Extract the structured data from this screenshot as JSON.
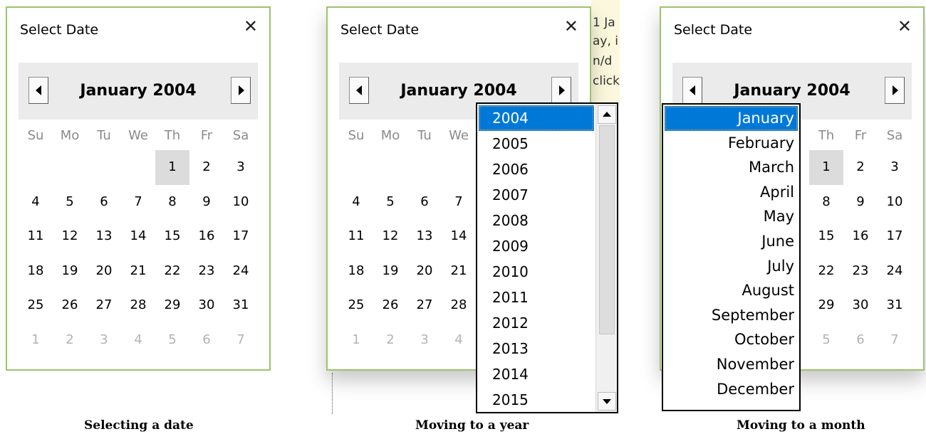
{
  "weekdays": [
    "Su",
    "Mo",
    "Tu",
    "We",
    "Th",
    "Fr",
    "Sa"
  ],
  "panels": [
    {
      "title": "Select Date",
      "month": "January",
      "year": "2004",
      "caption": "Selecting a date",
      "weeks": [
        [
          "",
          "",
          "",
          "",
          "1",
          "2",
          "3"
        ],
        [
          "4",
          "5",
          "6",
          "7",
          "8",
          "9",
          "10"
        ],
        [
          "11",
          "12",
          "13",
          "14",
          "15",
          "16",
          "17"
        ],
        [
          "18",
          "19",
          "20",
          "21",
          "22",
          "23",
          "24"
        ],
        [
          "25",
          "26",
          "27",
          "28",
          "29",
          "30",
          "31"
        ],
        [
          "1",
          "2",
          "3",
          "4",
          "5",
          "6",
          "7"
        ]
      ]
    },
    {
      "title": "Select Date",
      "month": "January",
      "year": "2004",
      "caption": "Moving to a year",
      "weekdays_visible": [
        "Su",
        "Mo",
        "Tu",
        "We"
      ],
      "weeks": [
        [
          "",
          "",
          "",
          ""
        ],
        [
          "4",
          "5",
          "6",
          "7"
        ],
        [
          "11",
          "12",
          "13",
          "14"
        ],
        [
          "18",
          "19",
          "20",
          "21"
        ],
        [
          "25",
          "26",
          "27",
          "28"
        ],
        [
          "1",
          "2",
          "3",
          "4"
        ]
      ]
    },
    {
      "title": "Select Date",
      "month": "January",
      "year": "2004",
      "caption": "Moving to a month",
      "weekdays_visible": [
        "Th",
        "Fr",
        "Sa"
      ],
      "weeks": [
        [
          "1",
          "2",
          "3"
        ],
        [
          "8",
          "9",
          "10"
        ],
        [
          "15",
          "16",
          "17"
        ],
        [
          "22",
          "23",
          "24"
        ],
        [
          "29",
          "30",
          "31"
        ],
        [
          "5",
          "6",
          "7"
        ]
      ]
    }
  ],
  "year_dropdown": {
    "selected": "2004",
    "items": [
      "2004",
      "2005",
      "2006",
      "2007",
      "2008",
      "2009",
      "2010",
      "2011",
      "2012",
      "2013",
      "2014",
      "2015"
    ]
  },
  "month_dropdown": {
    "selected": "January",
    "items": [
      "January",
      "February",
      "March",
      "April",
      "May",
      "June",
      "July",
      "August",
      "September",
      "October",
      "November",
      "December"
    ]
  },
  "background_text": [
    "1 Ja",
    "ay, i",
    "n/d",
    "click"
  ],
  "icons": {
    "close": "close-icon",
    "prev": "triangle-left-icon",
    "next": "triangle-right-icon",
    "scroll_up": "scroll-up-arrow-icon",
    "scroll_down": "scroll-down-arrow-icon"
  },
  "colors": {
    "border": "#9bc36b",
    "highlight": "#0078d7",
    "selected_day_bg": "#dcdcdc",
    "header_bg": "#ebebeb",
    "dim_text": "#b3b3b3"
  }
}
